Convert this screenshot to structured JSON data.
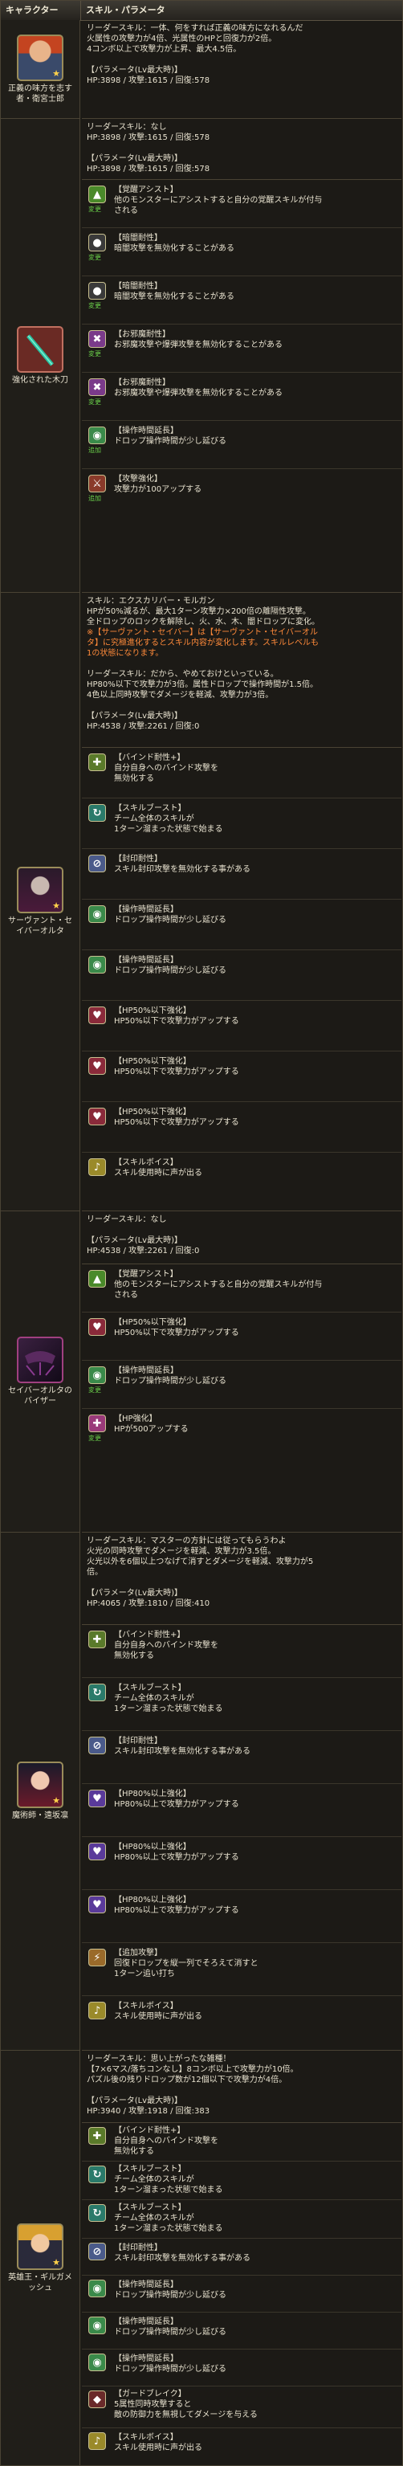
{
  "header": {
    "col_character": "キャラクター",
    "col_skill": "スキル・パラメータ"
  },
  "tags": {
    "change": "変更",
    "add": "追加"
  },
  "characters": [
    {
      "name": "正義の味方を志す者・衛宮士郎",
      "icon": "character-portrait-red-hair"
    },
    {
      "name": "強化された木刀",
      "icon": "wooden-sword-icon"
    },
    {
      "name": "サーヴァント・セイバーオルタ",
      "icon": "character-portrait-dark"
    },
    {
      "name": "セイバーオルタのバイザー",
      "icon": "visor-icon"
    },
    {
      "name": "魔術師・遠坂凛",
      "icon": "character-portrait-twin-tails"
    },
    {
      "name": "英雄王・ギルガメッシュ",
      "icon": "character-portrait-gold"
    }
  ],
  "c1": {
    "lines": [
      "リーダースキル：一体、何をすれば正義の味方になれるんだ",
      "火属性の攻撃力が4倍、光属性のHPと回復力が2倍。",
      "4コンボ以上で攻撃力が上昇、最大4.5倍。",
      "",
      "【パラメータ(Lv最大時)】",
      "HP:3898 / 攻撃:1615 / 回復:578"
    ]
  },
  "c2": {
    "lines": [
      "リーダースキル：なし",
      "HP:3898 / 攻撃:1615 / 回復:578",
      "",
      "【パラメータ(Lv最大時)】",
      "HP:3898 / 攻撃:1615 / 回復:578"
    ],
    "awakenings": [
      {
        "title": "【覚醒アシスト】",
        "desc": "他のモンスターにアシストすると自分の覚醒スキルが付与",
        "desc2": "される",
        "tag": "変更"
      },
      {
        "title": "【暗闇耐性】",
        "desc": "暗闇攻撃を無効化することがある",
        "tag": "変更"
      },
      {
        "title": "【暗闇耐性】",
        "desc": "暗闇攻撃を無効化することがある",
        "tag": "変更"
      },
      {
        "title": "【お邪魔耐性】",
        "desc": "お邪魔攻撃や爆弾攻撃を無効化することがある",
        "tag": "変更"
      },
      {
        "title": "【お邪魔耐性】",
        "desc": "お邪魔攻撃や爆弾攻撃を無効化することがある",
        "tag": "変更"
      },
      {
        "title": "【操作時間延長】",
        "desc": "ドロップ操作時間が少し延びる",
        "tag": "追加"
      },
      {
        "title": "【攻撃強化】",
        "desc": "攻撃力が100アップする",
        "tag": "追加"
      }
    ]
  },
  "c3": {
    "lines": [
      "スキル：エクスカリバー・モルガン",
      "HPが50%減るが、最大1ターン攻撃力×200倍の離隔性攻撃。",
      "全ドロップのロックを解除し、火、水、木、闇ドロップに変化。",
      "※【サーヴァント・セイバー】は【サーヴァント・セイバーオル",
      "タ】に究極進化するとスキル内容が変化します。スキルレベルも",
      "1の状態になります。",
      "",
      "リーダースキル：だから、やめておけといっている。",
      "HP80%以下で攻撃力が3倍。属性ドロップで操作時間が1.5倍。",
      "4色以上同時攻撃でダメージを軽減、攻撃力が3倍。",
      "",
      "【パラメータ(Lv最大時)】",
      "HP:4538 / 攻撃:2261 / 回復:0"
    ],
    "awakenings": [
      {
        "title": "【バインド耐性+】",
        "desc": "自分自身へのバインド攻撃を",
        "desc2": "無効化する",
        "tag": ""
      },
      {
        "title": "【スキルブースト】",
        "desc": "チーム全体のスキルが",
        "desc2": "1ターン溜まった状態で始まる",
        "tag": ""
      },
      {
        "title": "【封印耐性】",
        "desc": "スキル封印攻撃を無効化する事がある",
        "tag": ""
      },
      {
        "title": "【操作時間延長】",
        "desc": "ドロップ操作時間が少し延びる",
        "tag": ""
      },
      {
        "title": "【操作時間延長】",
        "desc": "ドロップ操作時間が少し延びる",
        "tag": ""
      },
      {
        "title": "【HP50%以下強化】",
        "desc": "HP50%以下で攻撃力がアップする",
        "tag": ""
      },
      {
        "title": "【HP50%以下強化】",
        "desc": "HP50%以下で攻撃力がアップする",
        "tag": ""
      },
      {
        "title": "【HP50%以下強化】",
        "desc": "HP50%以下で攻撃力がアップする",
        "tag": ""
      },
      {
        "title": "【スキルボイス】",
        "desc": "スキル使用時に声が出る",
        "tag": ""
      }
    ]
  },
  "c4": {
    "lines": [
      "リーダースキル：なし",
      "",
      "【パラメータ(Lv最大時)】",
      "HP:4538 / 攻撃:2261 / 回復:0"
    ],
    "awakenings": [
      {
        "title": "【覚醒アシスト】",
        "desc": "他のモンスターにアシストすると自分の覚醒スキルが付与",
        "desc2": "される",
        "tag": ""
      },
      {
        "title": "【HP50%以下強化】",
        "desc": "HP50%以下で攻撃力がアップする",
        "tag": ""
      },
      {
        "title": "【操作時間延長】",
        "desc": "ドロップ操作時間が少し延びる",
        "tag": "変更"
      },
      {
        "title": "【HP強化】",
        "desc": "HPが500アップする",
        "tag": "変更"
      }
    ]
  },
  "c5": {
    "lines": [
      "リーダースキル：マスターの方針には従ってもらうわよ",
      "火光の同時攻撃でダメージを軽減、攻撃力が3.5倍。",
      "火光以外を6個以上つなげて消すとダメージを軽減、攻撃力が5",
      "倍。",
      "",
      "【パラメータ(Lv最大時)】",
      "HP:4065 / 攻撃:1810 / 回復:410"
    ],
    "awakenings": [
      {
        "title": "【バインド耐性+】",
        "desc": "自分自身へのバインド攻撃を",
        "desc2": "無効化する",
        "tag": ""
      },
      {
        "title": "【スキルブースト】",
        "desc": "チーム全体のスキルが",
        "desc2": "1ターン溜まった状態で始まる",
        "tag": ""
      },
      {
        "title": "【封印耐性】",
        "desc": "スキル封印攻撃を無効化する事がある",
        "tag": ""
      },
      {
        "title": "【HP80%以上強化】",
        "desc": "HP80%以上で攻撃力がアップする",
        "tag": ""
      },
      {
        "title": "【HP80%以上強化】",
        "desc": "HP80%以上で攻撃力がアップする",
        "tag": ""
      },
      {
        "title": "【HP80%以上強化】",
        "desc": "HP80%以上で攻撃力がアップする",
        "tag": ""
      },
      {
        "title": "【追加攻撃】",
        "desc": "回復ドロップを縦一列でそろえて消すと",
        "desc2": "1ターン追い打ち",
        "tag": ""
      },
      {
        "title": "【スキルボイス】",
        "desc": "スキル使用時に声が出る",
        "tag": ""
      }
    ]
  },
  "c6": {
    "lines": [
      "リーダースキル：思い上がったな雑種！",
      "【7×6マス/落ちコンなし】8コンボ以上で攻撃力が10倍。",
      "パズル後の残りドロップ数が12個以下で攻撃力が4倍。",
      "",
      "【パラメータ(Lv最大時)】",
      "HP:3940 / 攻撃:1918 / 回復:383"
    ],
    "awakenings": [
      {
        "title": "【バインド耐性+】",
        "desc": "自分自身へのバインド攻撃を",
        "desc2": "無効化する",
        "tag": ""
      },
      {
        "title": "【スキルブースト】",
        "desc": "チーム全体のスキルが",
        "desc2": "1ターン溜まった状態で始まる",
        "tag": ""
      },
      {
        "title": "【スキルブースト】",
        "desc": "チーム全体のスキルが",
        "desc2": "1ターン溜まった状態で始まる",
        "tag": ""
      },
      {
        "title": "【封印耐性】",
        "desc": "スキル封印攻撃を無効化する事がある",
        "tag": ""
      },
      {
        "title": "【操作時間延長】",
        "desc": "ドロップ操作時間が少し延びる",
        "tag": ""
      },
      {
        "title": "【操作時間延長】",
        "desc": "ドロップ操作時間が少し延びる",
        "tag": ""
      },
      {
        "title": "【操作時間延長】",
        "desc": "ドロップ操作時間が少し延びる",
        "tag": ""
      },
      {
        "title": "【ガードブレイク】",
        "desc": "5属性同時攻撃すると",
        "desc2": "敵の防御力を無視してダメージを与える",
        "tag": ""
      },
      {
        "title": "【スキルボイス】",
        "desc": "スキル使用時に声が出る",
        "tag": ""
      }
    ]
  },
  "colors": {
    "background": "#1c1a16",
    "border": "#4a4334",
    "text": "#e8e2cf",
    "highlight_orange": "#ff8a3a",
    "tag_green": "#6ad04a"
  }
}
